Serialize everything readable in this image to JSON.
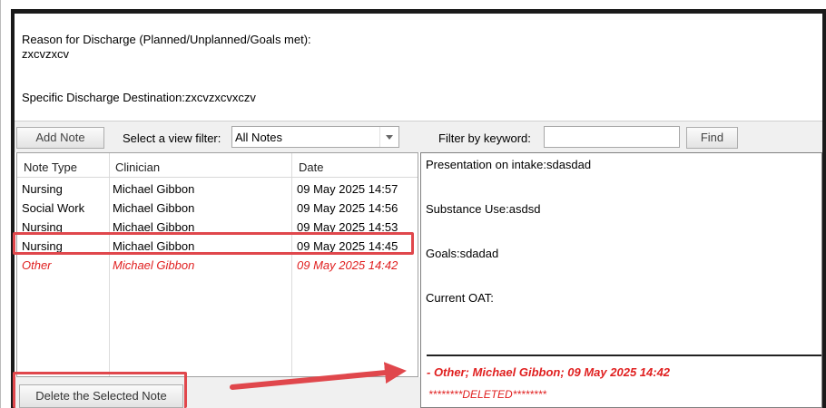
{
  "discharge": {
    "reason_label": "Reason for Discharge (Planned/Unplanned/Goals met):",
    "reason_value": "zxcvzxcv",
    "destination_line": "Specific Discharge Destination:zxcvzxcvxczv"
  },
  "toolbar": {
    "add_note_label": "Add Note",
    "view_filter_label": "Select a view filter:",
    "view_filter_value": "All Notes",
    "keyword_label": "Filter by keyword:",
    "keyword_value": "",
    "find_label": "Find"
  },
  "notes_table": {
    "columns": [
      "Note Type",
      "Clinician",
      "Date"
    ],
    "rows": [
      {
        "type": "Nursing",
        "clinician": "Michael Gibbon",
        "date": "09 May 2025 14:57"
      },
      {
        "type": "Social Work",
        "clinician": "Michael Gibbon",
        "date": "09 May 2025 14:56"
      },
      {
        "type": "Nursing",
        "clinician": "Michael Gibbon",
        "date": "09 May 2025 14:53"
      },
      {
        "type": "Nursing",
        "clinician": "Michael Gibbon",
        "date": "09 May 2025 14:45"
      },
      {
        "type": "Other",
        "clinician": "Michael Gibbon",
        "date": "09 May 2025 14:42"
      }
    ]
  },
  "delete_button_label": "Delete the Selected Note",
  "note_detail": {
    "lines": [
      "Presentation on intake:sdasdad",
      "Substance Use:asdsd",
      "Goals:sdadad",
      "Current OAT:"
    ],
    "deleted_header": "- Other; Michael Gibbon; 09 May 2025 14:42",
    "deleted_marker": "********DELETED********"
  },
  "colors": {
    "annotation_red": "#e0474c",
    "deleted_text": "#e02020"
  }
}
